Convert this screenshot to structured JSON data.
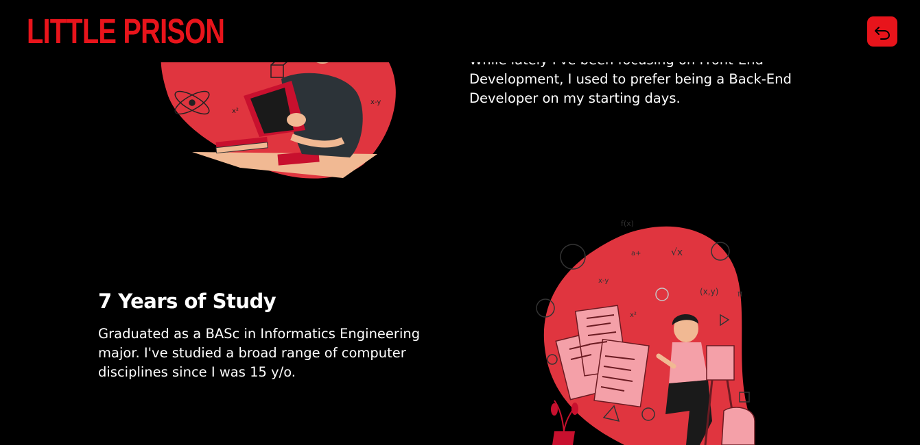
{
  "header": {
    "logo": "LITTLE PRISON",
    "back_button_icon": "undo-arrow-icon"
  },
  "section_backend": {
    "paragraph_line1": "While lately I've been focusing on Front-End",
    "paragraph_line2": "Development, I used to prefer being a Back-End",
    "paragraph_line3": "Developer on my starting days."
  },
  "section_study": {
    "title": "7 Years of Study",
    "paragraph_line1": "Graduated as a BASc in Informatics Engineering",
    "paragraph_line2": "major. I've studied a broad range of computer",
    "paragraph_line3": "disciplines since I was 15 y/o."
  },
  "colors": {
    "background": "#000000",
    "accent": "#e8141b",
    "blob": "#e0353f",
    "text": "#ffffff"
  }
}
